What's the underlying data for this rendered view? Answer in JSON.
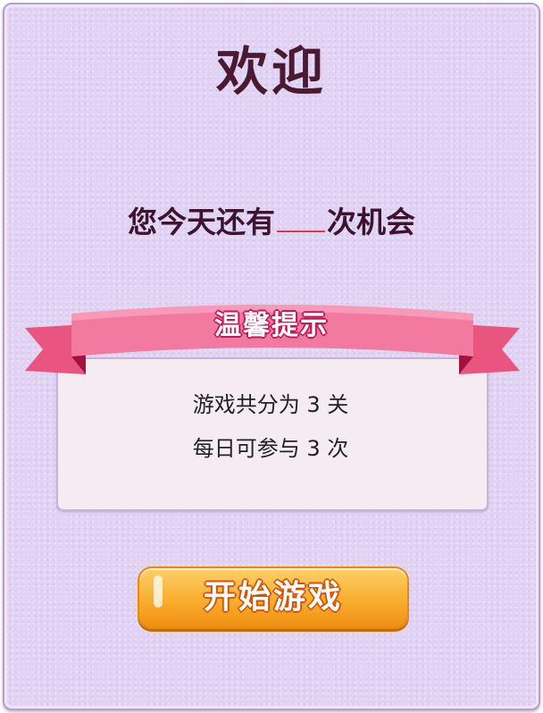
{
  "header": {
    "title": "欢迎"
  },
  "chances": {
    "prefix": "您今天还有",
    "count": "",
    "suffix": "次机会"
  },
  "tips": {
    "ribbon_title": "温馨提示",
    "lines": [
      "游戏共分为 3 关",
      "每日可参与 3 次"
    ]
  },
  "start_button": {
    "label": "开始游戏"
  },
  "colors": {
    "background": "#e1d3f3",
    "title": "#4a1a33",
    "ribbon": "#f06b93",
    "ribbon_dark": "#a3123f",
    "button": "#f9ae2e",
    "blank_underline": "#e03a4a"
  }
}
